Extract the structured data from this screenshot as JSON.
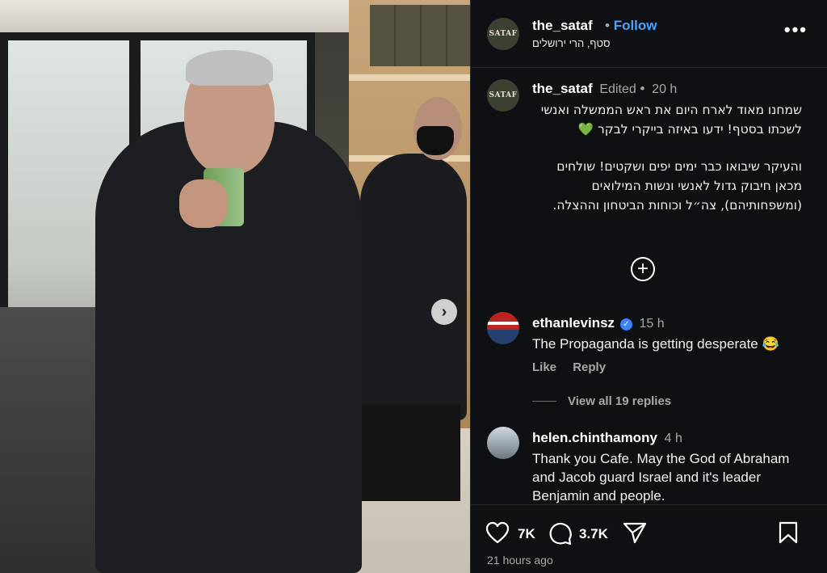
{
  "header": {
    "avatar_text": "SATAF",
    "username": "the_sataf",
    "separator": "•",
    "follow_label": "Follow",
    "location": "סטף, הרי ירושלים",
    "more_label": "•••"
  },
  "caption": {
    "username": "the_sataf",
    "edited_label": "Edited",
    "separator": "•",
    "time": "20 h",
    "paragraph_1": "שמחנו מאוד לארח היום את ראש הממשלה ואנשי לשכתו בסטף! ידעו באיזה בייקרי לבקר 💚",
    "paragraph_2": "והעיקר שיבואו כבר ימים יפים ושקטים! שולחים מכאן חיבוק גדול לאנשי ונשות המילואים (ומשפחותיהם), צה״ל וכוחות הביטחון וההצלה."
  },
  "load_more_icon": "plus-circle-icon",
  "comments": [
    {
      "username": "ethanlevinsz",
      "verified_mark": "✓",
      "time": "15 h",
      "text": "The Propaganda is getting desperate 😂",
      "like_label": "Like",
      "reply_label": "Reply"
    },
    {
      "username": "helen.chinthamony",
      "time": "4 h",
      "text": "Thank you Cafe. May the God of Abraham and Jacob guard Israel and it's leader Benjamin and people."
    }
  ],
  "view_replies_label": "View all 19 replies",
  "footer": {
    "likes": "7K",
    "comments_count": "3.7K",
    "posted": "21 hours ago"
  },
  "photo": {
    "next_arrow": "›"
  },
  "colors": {
    "panel_bg": "#0e1013",
    "follow": "#4aa3ff",
    "verified": "#3b82f6",
    "muted": "#a8a8a8"
  }
}
